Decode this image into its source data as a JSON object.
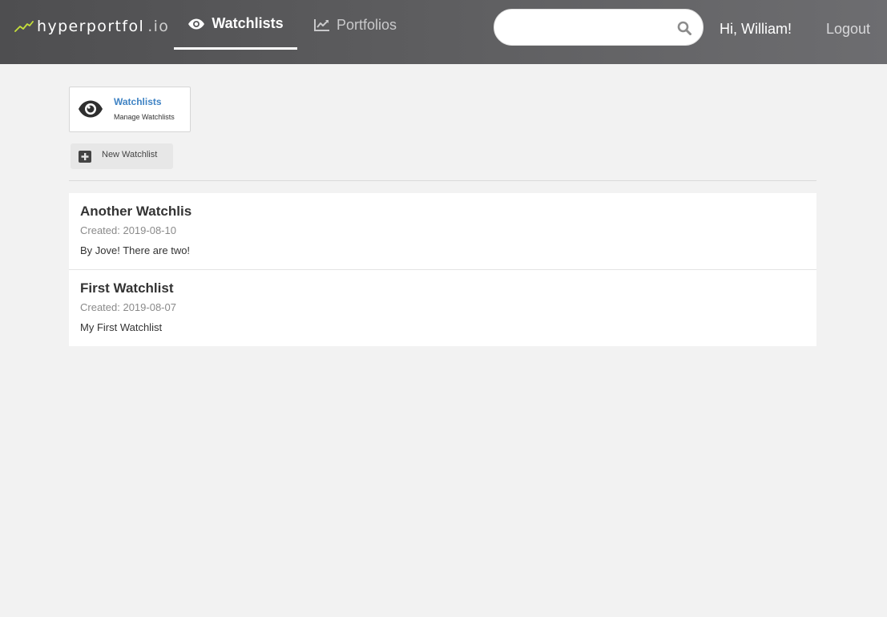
{
  "app": {
    "brand": "hyperportfol",
    "brand_suffix": ".io",
    "logo_icon": "trend-line-icon"
  },
  "nav": {
    "tabs": [
      {
        "label": "Watchlists",
        "icon": "eye-icon",
        "active": true
      },
      {
        "label": "Portfolios",
        "icon": "chart-line-icon",
        "active": false
      }
    ]
  },
  "search": {
    "value": "",
    "placeholder": "",
    "icon": "search-icon"
  },
  "user": {
    "greeting": "Hi, William!",
    "logout_label": "Logout"
  },
  "breadcrumb": {
    "title": "Watchlists",
    "subtitle": "Manage Watchlists",
    "icon": "eye-icon"
  },
  "actions": {
    "new_watchlist_label": "New Watchlist",
    "new_watchlist_icon": "plus-square-icon"
  },
  "watchlists": [
    {
      "name": "Another Watchlis",
      "created": "Created: 2019-08-10",
      "description": "By Jove! There are two!"
    },
    {
      "name": "First Watchlist",
      "created": "Created: 2019-08-07",
      "description": "My First Watchlist"
    }
  ],
  "colors": {
    "topbar": "#5e5e60",
    "link_blue": "#3f83c4",
    "logo_accent": "#c6e03a",
    "background": "#f2f2f2"
  }
}
